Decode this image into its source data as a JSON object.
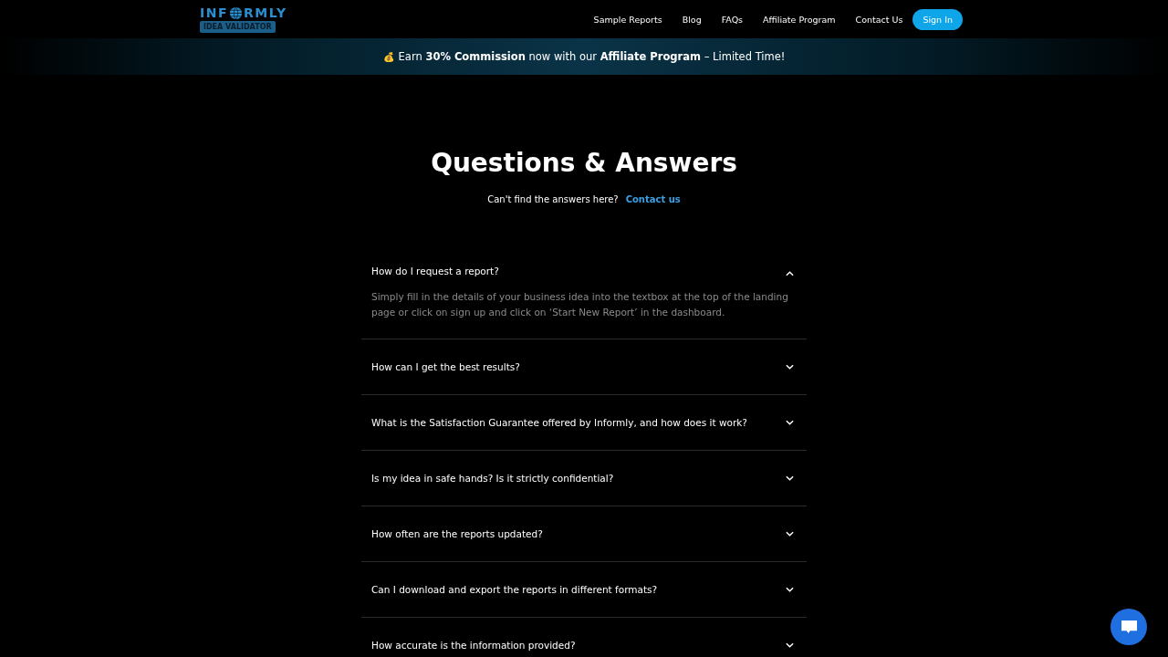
{
  "logo": {
    "text_before": "INF",
    "text_after": "RMLY",
    "tagline": "IDEA VALIDATOR"
  },
  "nav": {
    "links": [
      "Sample Reports",
      "Blog",
      "FAQs",
      "Affiliate Program",
      "Contact Us"
    ],
    "sign_in": "Sign In"
  },
  "banner": {
    "icon": "💰",
    "text": "Earn **30% Commission** now with our **Affiliate Program** – Limited Time!"
  },
  "heading": "Questions & Answers",
  "subheading": {
    "text": "Can't find the answers here?",
    "link": "Contact us"
  },
  "faqs": [
    {
      "question": "How do I request a report?",
      "expanded": true,
      "answer": "Simply fill in the details of your business idea into the textbox at the top of the landing page or click on sign up and click on ‘Start New Report’ in the dashboard."
    },
    {
      "question": "How can I get the best results?",
      "expanded": false
    },
    {
      "question": "What is the Satisfaction Guarantee offered by Informly, and how does it work?",
      "expanded": false
    },
    {
      "question": "Is my idea in safe hands? Is it strictly confidential?",
      "expanded": false
    },
    {
      "question": "How often are the reports updated?",
      "expanded": false
    },
    {
      "question": "Can I download and export the reports in different formats?",
      "expanded": false
    },
    {
      "question": "How accurate is the information provided?",
      "expanded": false
    }
  ]
}
